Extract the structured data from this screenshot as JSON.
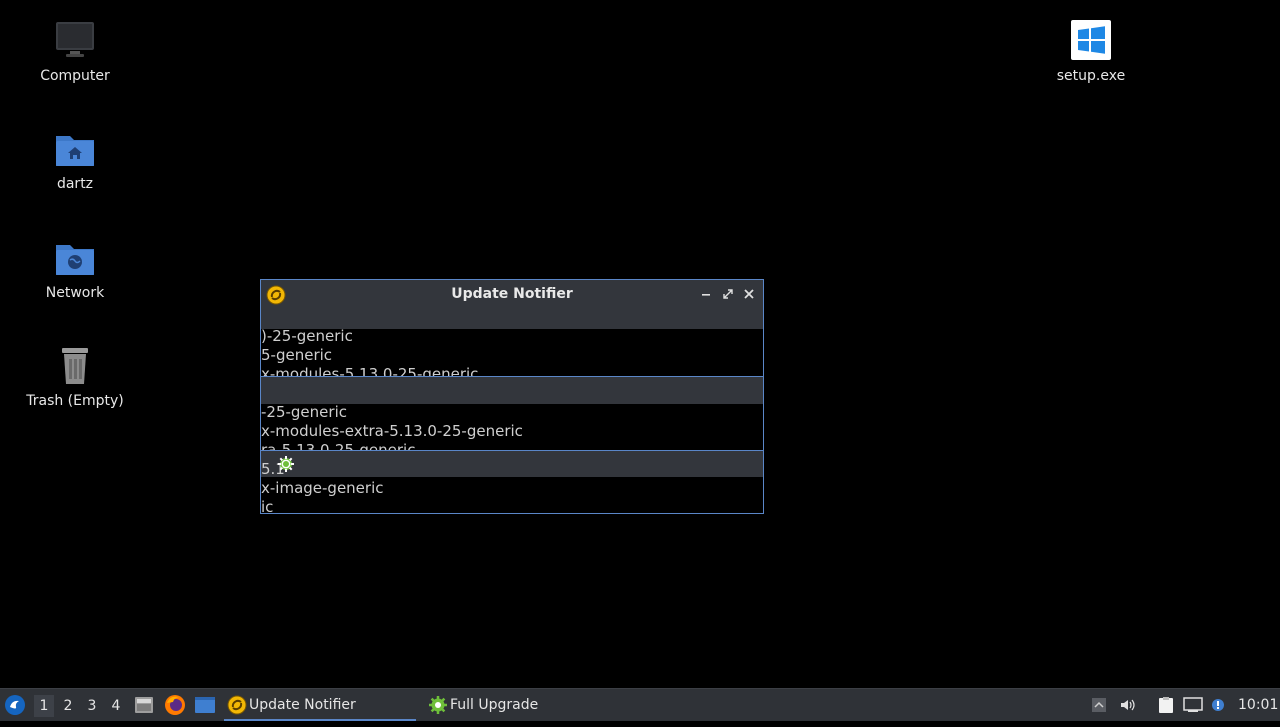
{
  "desktop": {
    "icons": [
      {
        "label": "Computer"
      },
      {
        "label": "dartz"
      },
      {
        "label": "Network"
      },
      {
        "label": "Trash (Empty)"
      },
      {
        "label": "setup.exe"
      }
    ]
  },
  "window": {
    "title": "Update Notifier",
    "lines": [
      ")-25-generic",
      "5-generic",
      "x-modules-5.13.0-25-generic",
      "-25-generic",
      "x-modules-extra-5.13.0-25-generic",
      "ra-5.13.0-25-generic",
      "5.1",
      "x-image-generic",
      "ic"
    ]
  },
  "taskbar": {
    "workspaces": [
      "1",
      "2",
      "3",
      "4"
    ],
    "tasks": [
      {
        "label": "Update Notifier"
      },
      {
        "label": "Full Upgrade"
      }
    ],
    "clock": "10:01"
  },
  "colors": {
    "accent": "#5a86c8",
    "folder": "#4a86d8",
    "taskbar": "#2f3237"
  }
}
